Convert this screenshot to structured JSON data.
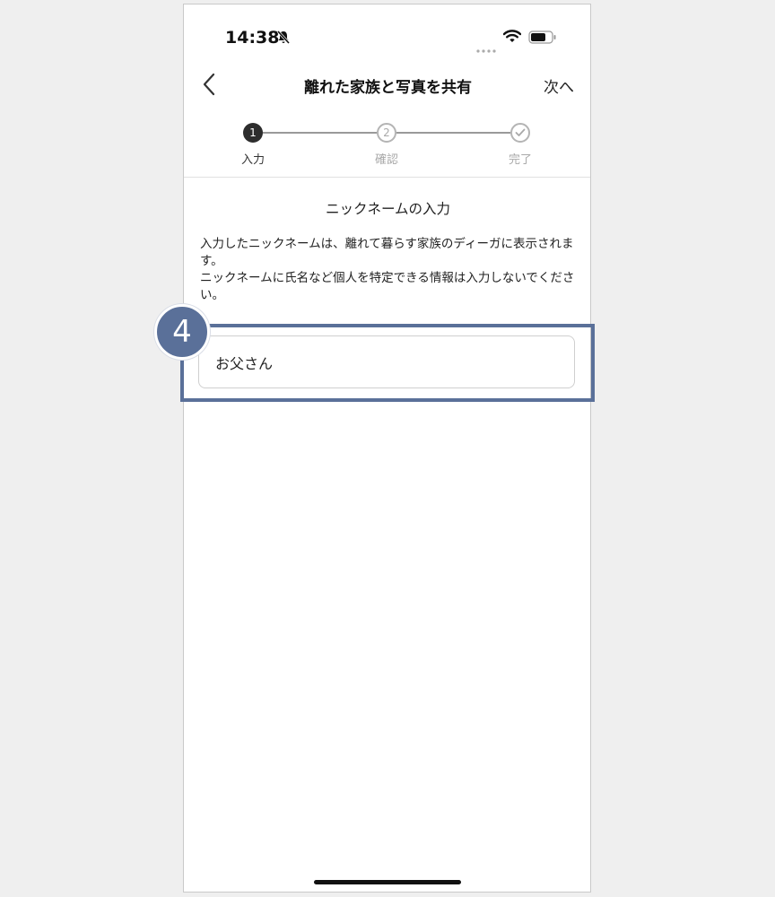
{
  "status_bar": {
    "time": "14:38"
  },
  "nav": {
    "title": "離れた家族と写真を共有",
    "next_label": "次へ"
  },
  "steps": [
    {
      "number": "1",
      "label": "入力"
    },
    {
      "number": "2",
      "label": "確認"
    },
    {
      "label": "完了"
    }
  ],
  "section": {
    "title": "ニックネームの入力",
    "description_1": "入力したニックネームは、離れて暮らす家族のディーガに表示されます。",
    "description_2": "ニックネームに氏名など個人を特定できる情報は入力しないでください。"
  },
  "nickname_field": {
    "value": "お父さん"
  },
  "annotation": {
    "badge_number": "4"
  },
  "colors": {
    "accent": "#5a7099",
    "step_active": "#2d2d2d",
    "step_inactive": "#b4b4b4"
  }
}
